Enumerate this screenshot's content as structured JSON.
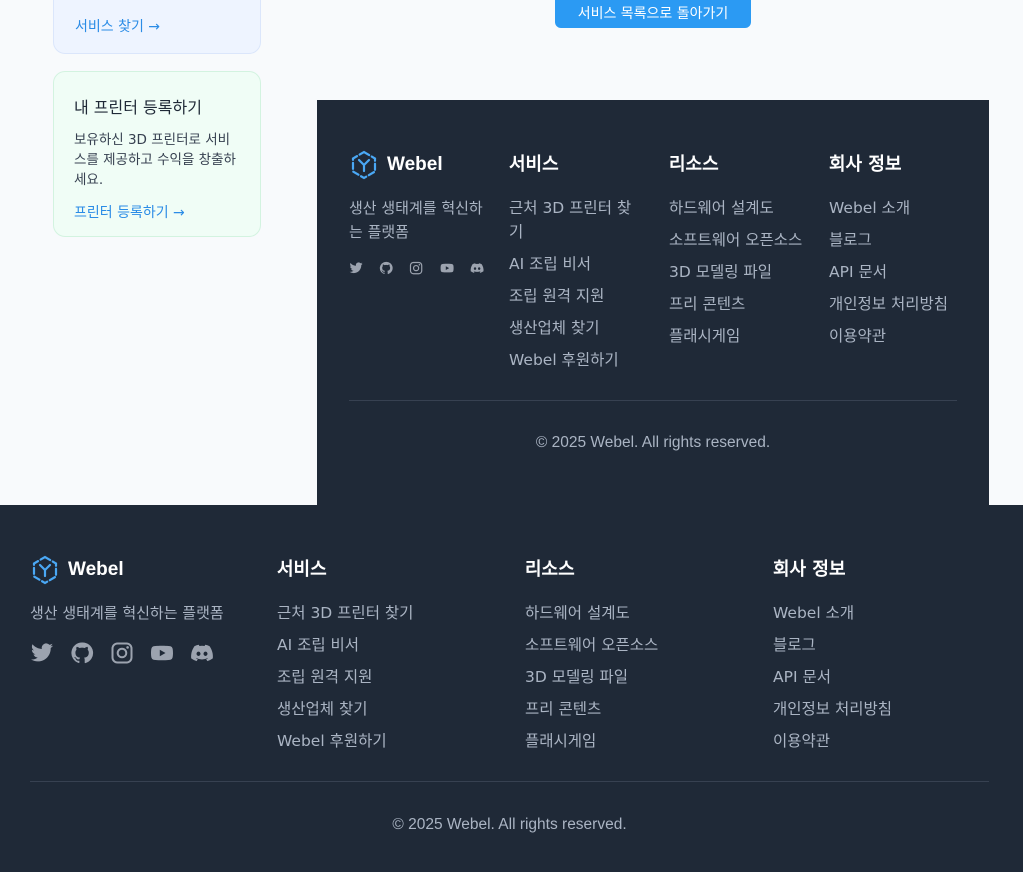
{
  "sidebar": {
    "service_card": {
      "link": "서비스 찾기 →"
    },
    "printer_card": {
      "title": "내 프린터 등록하기",
      "description": "보유하신 3D 프린터로 서비스를 제공하고 수익을 창출하세요.",
      "link": "프린터 등록하기 →"
    }
  },
  "main": {
    "back_button": "서비스 목록으로 돌아가기"
  },
  "footer": {
    "brand": "Webel",
    "tagline": "생산 생태계를 혁신하는 플랫폼",
    "social_icons": [
      "twitter-icon",
      "github-icon",
      "instagram-icon",
      "youtube-icon",
      "discord-icon"
    ],
    "services": {
      "title": "서비스",
      "links": [
        "근처 3D 프린터 찾기",
        "AI 조립 비서",
        "조립 원격 지원",
        "생산업체 찾기",
        "Webel 후원하기"
      ]
    },
    "resources": {
      "title": "리소스",
      "links": [
        "하드웨어 설계도",
        "소프트웨어 오픈소스",
        "3D 모델링 파일",
        "프리 콘텐츠",
        "플래시게임"
      ]
    },
    "company": {
      "title": "회사 정보",
      "links": [
        "Webel 소개",
        "블로그",
        "API 문서",
        "개인정보 처리방침",
        "이용약관"
      ]
    },
    "copyright": "© 2025 Webel. All rights reserved."
  },
  "colors": {
    "accent": "#2b9af3",
    "footer_bg": "#1f2937",
    "link_blue": "#2b8ce6"
  }
}
